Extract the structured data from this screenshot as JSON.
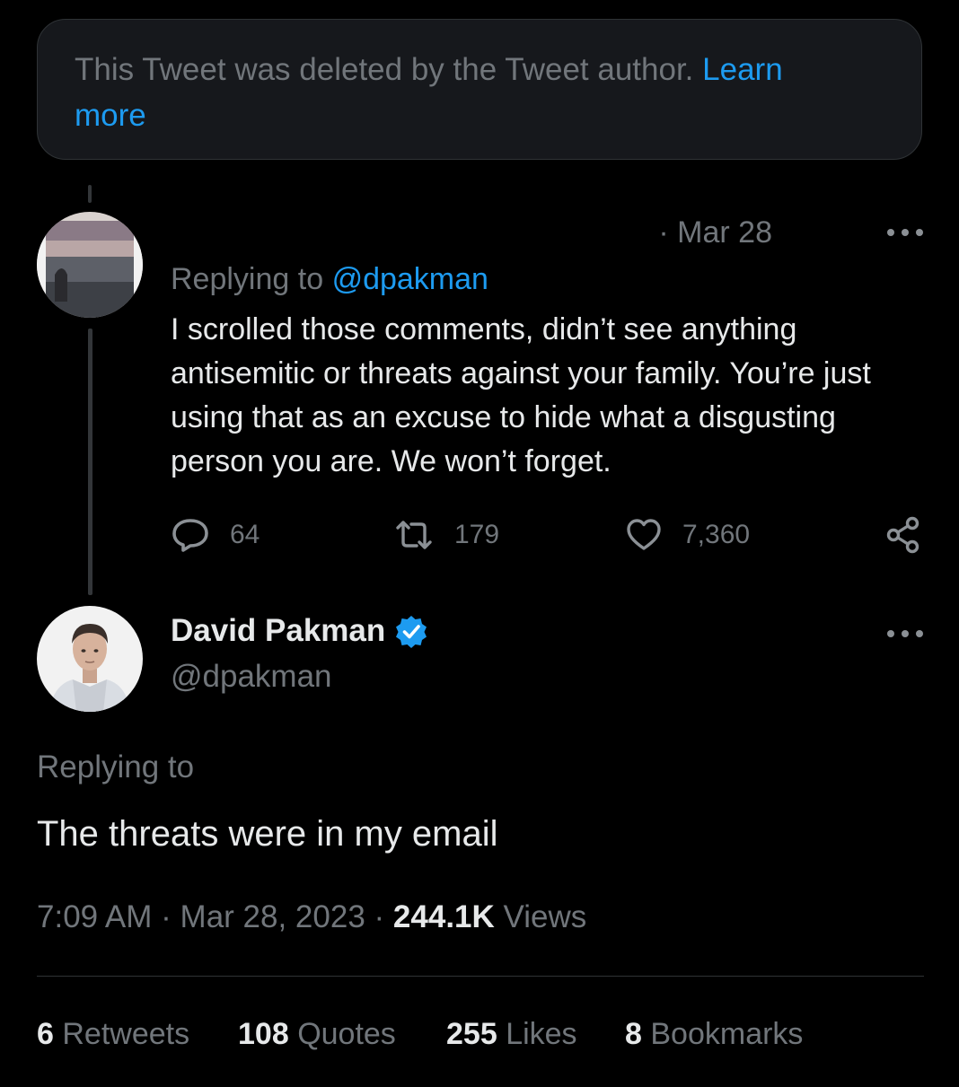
{
  "deleted_notice": {
    "text": "This Tweet was deleted by the Tweet author.",
    "link_line1": "Learn",
    "link_line2": "more"
  },
  "reply_tweet": {
    "date": "· Mar 28",
    "replying_label": "Replying to",
    "replying_handle": "@dpakman",
    "text": "I scrolled those comments, didn’t see anything antisemitic or threats against your family.  You’re just using that as an excuse to hide what a disgusting person you are.  We won’t forget.",
    "actions": {
      "replies": "64",
      "retweets": "179",
      "likes": "7,360"
    }
  },
  "main_tweet": {
    "author_name": "David Pakman",
    "author_handle": "@dpakman",
    "replying_label": "Replying to",
    "text": "The threats were in my email",
    "time": "7:09 AM",
    "date": "Mar 28, 2023",
    "views_count": "244.1K",
    "views_label": "Views",
    "stats": {
      "retweets_count": "6",
      "retweets_label": "Retweets",
      "quotes_count": "108",
      "quotes_label": "Quotes",
      "likes_count": "255",
      "likes_label": "Likes",
      "bookmarks_count": "8",
      "bookmarks_label": "Bookmarks"
    }
  },
  "colors": {
    "background": "#000000",
    "text": "#e7e9ea",
    "muted": "#71767b",
    "link": "#1d9bf0",
    "verified": "#1d9bf0"
  }
}
